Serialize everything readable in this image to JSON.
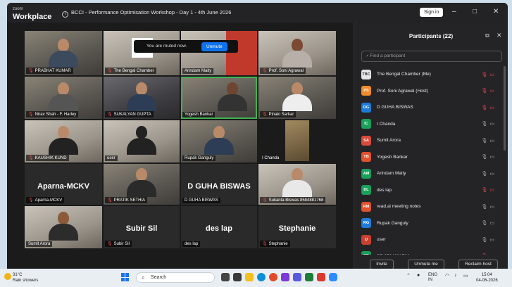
{
  "window": {
    "logo_small": "zoom",
    "logo_big": "Workplace",
    "info_icon": "i",
    "title": "BCCI - Performance Optimisation Workshop - Day 1 - 4th June 2026",
    "sign_in": "Sign in",
    "minimize": "–",
    "maximize": "□",
    "close": "✕"
  },
  "notice": {
    "text": "You are muted now.",
    "button": "Unmute"
  },
  "gallery": [
    {
      "label": "PRABHAT KUMAR",
      "muted": true
    },
    {
      "label": "The Bengal Chamber",
      "muted": true
    },
    {
      "label": "Arindam Maity",
      "muted": false
    },
    {
      "label": "Prof. Soni Agrawal",
      "muted": true
    },
    {
      "label": "Nirav Shah - F. Harley",
      "muted": true
    },
    {
      "label": "SUKALYAN GUPTA",
      "muted": true
    },
    {
      "label": "Yogesh Bankar",
      "muted": false
    },
    {
      "label": "Pinaki Sarkar",
      "muted": true
    },
    {
      "label": "KAUSHIK KUND",
      "muted": true
    },
    {
      "label": "user",
      "muted": false
    },
    {
      "label": "Rupak Ganguly",
      "muted": false
    },
    {
      "label": "I Chanda",
      "muted": false
    },
    {
      "bigname": "Aparna-MCKV",
      "label": "Aparna-MCKV",
      "muted": true
    },
    {
      "label": "PRATIK SETHIA",
      "muted": true
    },
    {
      "bigname": "D GUHA BISWAS",
      "label": "D GUHA BISWAS",
      "muted": false
    },
    {
      "label": "Sukanta Biswas 8584881768",
      "muted": true
    },
    {
      "label": "Sumit Arora",
      "muted": false
    },
    {
      "bigname": "Subir Sil",
      "label": "Subir Sil",
      "muted": true
    },
    {
      "bigname": "des lap",
      "label": "des lap",
      "muted": false
    },
    {
      "bigname": "Stephanie",
      "label": "Stephanie",
      "muted": true
    }
  ],
  "panel": {
    "title": "Participants (22)",
    "popout_icon": "⧉",
    "close_icon": "✕",
    "search_placeholder": "Find a participant",
    "participants": [
      {
        "initials": "TBC",
        "name": "The Bengal Chamber (Me)",
        "color": "#e6e6e6",
        "status": "red"
      },
      {
        "initials": "PS",
        "name": "Prof. Soni Agrawal (Host)",
        "color": "#f28c28",
        "status": "red"
      },
      {
        "initials": "DG",
        "name": "D GUHA BISWAS",
        "color": "#1f7bd8",
        "status": "red"
      },
      {
        "initials": "IC",
        "name": "I Chanda",
        "color": "#1aa05a",
        "status": "grey"
      },
      {
        "initials": "SA",
        "name": "Sumit Arora",
        "color": "#d94a3a",
        "status": "grey"
      },
      {
        "initials": "YB",
        "name": "Yogesh Bankar",
        "color": "#e0522e",
        "status": "grey"
      },
      {
        "initials": "AM",
        "name": "Arindam Maity",
        "color": "#1aa05a",
        "status": "grey"
      },
      {
        "initials": "DL",
        "name": "des lap",
        "color": "#1aa05a",
        "status": "red"
      },
      {
        "initials": "RM",
        "name": "read.ai meeting notes",
        "color": "#e0522e",
        "status": "grey"
      },
      {
        "initials": "RG",
        "name": "Rupak Ganguly",
        "color": "#1f7bd8",
        "status": "grey"
      },
      {
        "initials": "U",
        "name": "user",
        "color": "#c8402f",
        "status": "grey"
      },
      {
        "initials": "SB",
        "name": "SB 8584881768",
        "color": "#1aa05a",
        "status": "red"
      }
    ],
    "invite": "Invite",
    "unmute_me": "Unmute me",
    "reclaim_host": "Reclaim host"
  },
  "taskbar": {
    "temp": "31°C",
    "weather": "Rain showers",
    "search": "Search",
    "search_icon": "⌕",
    "lang1": "ENG",
    "lang2": "IN",
    "time": "15:04",
    "date": "04-06-2026"
  }
}
